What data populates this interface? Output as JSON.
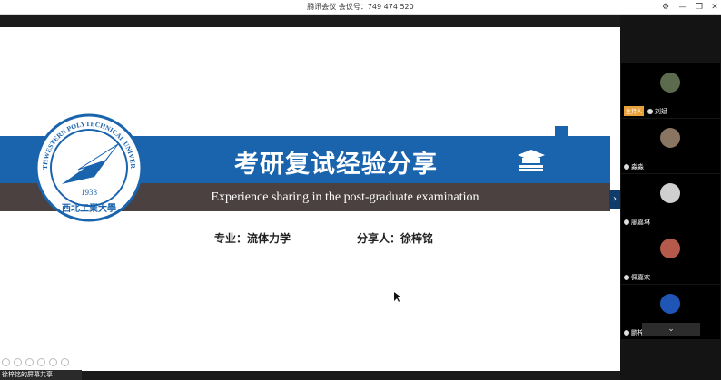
{
  "window": {
    "title": "腾讯会议 会议号：749 474 520",
    "buttons": {
      "settings": "⚙",
      "minimize": "—",
      "restore": "❐",
      "close": "✕"
    }
  },
  "slide": {
    "title": "考研复试经验分享",
    "subtitle": "Experience sharing in the post-graduate examination",
    "major": "专业：流体力学",
    "presenter": "分享人：徐梓铭",
    "logo_text_top": "NORTHWESTERN POLYTECHNICAL UNIVERSITY",
    "logo_year": "1938",
    "logo_text_bottom": "西北工業大學",
    "colors": {
      "blue": "#1a63ad",
      "dark": "#4a4140"
    }
  },
  "share_bar": {
    "label": "徐梓铭的屏幕共享"
  },
  "participants": [
    {
      "name": "刘斌",
      "host_label": "主持人",
      "is_host": true,
      "avatar_color": "#5c6b4e"
    },
    {
      "name": "淼淼",
      "is_host": false,
      "avatar_color": "#8a7563"
    },
    {
      "name": "廖嘉琳",
      "is_host": false,
      "avatar_color": "#cfcfcf"
    },
    {
      "name": "佩嘉欢",
      "is_host": false,
      "avatar_color": "#b55a4a"
    },
    {
      "name": "鹏梓亭",
      "is_host": false,
      "avatar_color": "#1f56b5"
    }
  ],
  "sidebar": {
    "more_label": "⌄"
  },
  "icons": {
    "next_slide": "chevron-right-icon",
    "mic": "mic-icon"
  }
}
